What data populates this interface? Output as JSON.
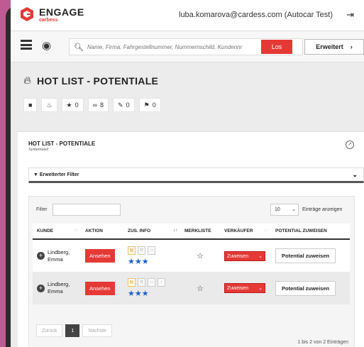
{
  "header": {
    "brand": "ENGAGE",
    "brand_sub": "carbess",
    "user": "luba.komarova@cardess.com (Autocar Test)"
  },
  "search": {
    "placeholder": "Name, Firma, Fahrgestellnummer, Nummernschild, Kundennr",
    "submit_label": "Los",
    "advanced_label": "Erweitert"
  },
  "page": {
    "title": "HOT LIST - POTENTIALE",
    "stats": [
      {
        "icon": "camera-icon",
        "value": ""
      },
      {
        "icon": "flame-icon",
        "value": ""
      },
      {
        "icon": "star-icon",
        "value": "0"
      },
      {
        "icon": "link-icon",
        "value": "8"
      },
      {
        "icon": "edit-icon",
        "value": "0"
      },
      {
        "icon": "flag-icon",
        "value": "0"
      }
    ]
  },
  "panel": {
    "title": "HOT LIST - POTENTIALE",
    "subtitle": "Systemweit",
    "filter_bar_label": "Erweiterter Filter",
    "filter_label": "Filter",
    "page_length": "10",
    "page_length_label": "Einträge anzeigen",
    "columns": [
      "KUNDE",
      "AKTION",
      "ZUS. INFO",
      "MERKLISTE",
      "VERKÄUFER",
      "POTENTIAL ZUWEISEN"
    ],
    "rows": [
      {
        "kunde": "Lindberg,\nEmma",
        "aktion": "Ansehen",
        "stars": "★★★",
        "verkaeufer": "Zuweisen",
        "potential": "Potential zuweisen"
      },
      {
        "kunde": "Lindberg,\nEmma",
        "aktion": "Ansehen",
        "stars": "★★★",
        "verkaeufer": "Zuweisen",
        "potential": "Potential zuweisen"
      }
    ],
    "pager": {
      "prev": "Zurück",
      "current": "1",
      "next": "Nächste"
    },
    "info": "1 bis 2 von 2 Einträgen"
  },
  "colors": {
    "accent": "#e53935",
    "star": "#1e5fc8"
  }
}
